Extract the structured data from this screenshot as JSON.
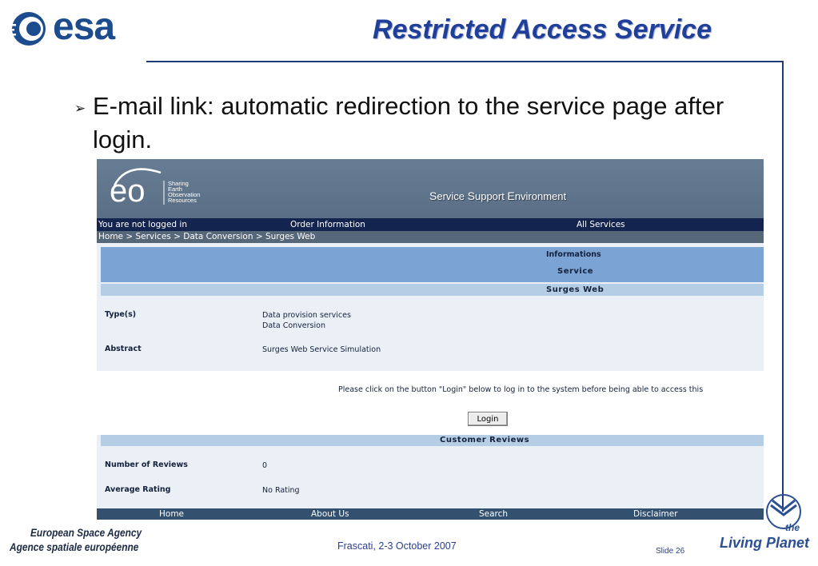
{
  "slide": {
    "logo_text": "esa",
    "title": "Restricted Access Service",
    "bullet": "E-mail link: automatic redirection to the service page after login.",
    "agency_en": "European Space Agency",
    "agency_fr": "Agence spatiale européenne",
    "venue": "Frascati, 2-3 October 2007",
    "slide_number": "Slide 26",
    "brand_logo": {
      "line1": "the",
      "line2": "Living Planet"
    }
  },
  "web": {
    "logo": {
      "mark": "eo",
      "lines": [
        "Sharing",
        "Earth",
        "Observation",
        "Resources"
      ]
    },
    "title": {
      "s1": "S",
      "w1": "ervice ",
      "s2": "S",
      "w2": "upport ",
      "s3": "E",
      "w3": "nvironment"
    },
    "nav": {
      "status": "You are not logged in",
      "order": "Order Information",
      "services": "All Services"
    },
    "breadcrumb": "Home > Services > Data Conversion > Surges Web",
    "section": {
      "informations": "Informations",
      "service": "Service",
      "name": "Surges Web"
    },
    "details": {
      "types_label": "Type(s)",
      "types_values": [
        "Data provision services",
        "Data Conversion"
      ],
      "abstract_label": "Abstract",
      "abstract_value": "Surges Web Service Simulation"
    },
    "notice": "Please click on the button \"Login\" below to log in to the system before being able to access this",
    "login_label": "Login",
    "reviews": {
      "title": "Customer Reviews",
      "count_label": "Number of Reviews",
      "count_value": "0",
      "rating_label": "Average Rating",
      "rating_value": "No Rating"
    },
    "footer": [
      "Home",
      "About Us",
      "Search",
      "Disclaimer"
    ]
  },
  "colors": {
    "title_blue": "#1f3f9a",
    "frame": "#1e3a78",
    "header_bg": "#677d94",
    "nav_bg": "#13244e",
    "band_blue": "#7ba4d4",
    "band_light": "#b6cee5",
    "footer_bg": "#33516e"
  }
}
